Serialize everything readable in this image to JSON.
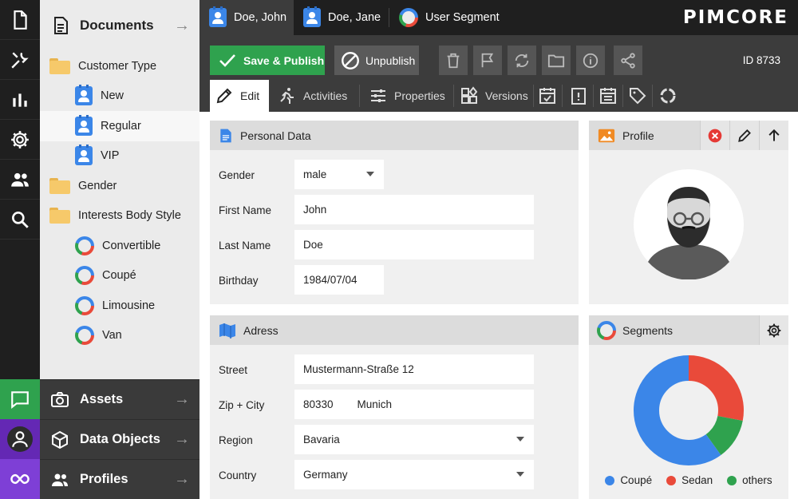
{
  "rail": {
    "items": [
      {
        "name": "documents-rail-icon"
      },
      {
        "name": "tools-rail-icon"
      },
      {
        "name": "reports-rail-icon"
      },
      {
        "name": "settings-rail-icon"
      },
      {
        "name": "users-rail-icon"
      },
      {
        "name": "search-rail-icon"
      }
    ]
  },
  "tree": {
    "header": "Documents",
    "items": [
      {
        "label": "Customer Type",
        "icon": "folder-icon"
      },
      {
        "label": "New",
        "icon": "person-icon"
      },
      {
        "label": "Regular",
        "icon": "person-icon",
        "selected": true
      },
      {
        "label": "VIP",
        "icon": "person-icon"
      },
      {
        "label": "Gender",
        "icon": "folder-icon"
      },
      {
        "label": "Interests Body Style",
        "icon": "folder-icon"
      },
      {
        "label": "Convertible",
        "icon": "segment-icon"
      },
      {
        "label": "Coupé",
        "icon": "segment-icon"
      },
      {
        "label": "Limousine",
        "icon": "segment-icon"
      },
      {
        "label": "Van",
        "icon": "segment-icon"
      }
    ]
  },
  "accordion": {
    "assets": "Assets",
    "data_objects": "Data Objects",
    "profiles": "Profiles"
  },
  "tabs": [
    {
      "label": "Doe, John"
    },
    {
      "label": "Doe, Jane"
    },
    {
      "label": "User Segment"
    }
  ],
  "logo": "PIMCORE",
  "toolbar": {
    "save_label": "Save & Publish",
    "unpublish_label": "Unpublish",
    "id_label": "ID  8733"
  },
  "subtabs": {
    "edit": "Edit",
    "activities": "Activities",
    "properties": "Properties",
    "versions": "Versions"
  },
  "personal": {
    "title": "Personal Data",
    "gender_label": "Gender",
    "gender_value": "male",
    "first_name_label": "First Name",
    "first_name_value": "John",
    "last_name_label": "Last Name",
    "last_name_value": "Doe",
    "birthday_label": "Birthday",
    "birthday_value": "1984/07/04"
  },
  "address": {
    "title": "Adress",
    "street_label": "Street",
    "street_value": "Mustermann-Straße 12",
    "zip_label": "Zip + City",
    "zip_value": "80330",
    "city_value": "Munich",
    "region_label": "Region",
    "region_value": "Bavaria",
    "country_label": "Country",
    "country_value": "Germany"
  },
  "profile": {
    "title": "Profile"
  },
  "segments": {
    "title": "Segments"
  },
  "colors": {
    "accent_green": "#2fa24e",
    "blue": "#3b86e8",
    "red": "#e94a3a",
    "purple": "#6428b4"
  },
  "chart_data": {
    "type": "pie",
    "categories": [
      "Coupé",
      "Sedan",
      "others"
    ],
    "values": [
      60,
      28,
      12
    ],
    "colors": [
      "#3b86e8",
      "#e94a3a",
      "#2fa24e"
    ],
    "legend": "bottom"
  }
}
